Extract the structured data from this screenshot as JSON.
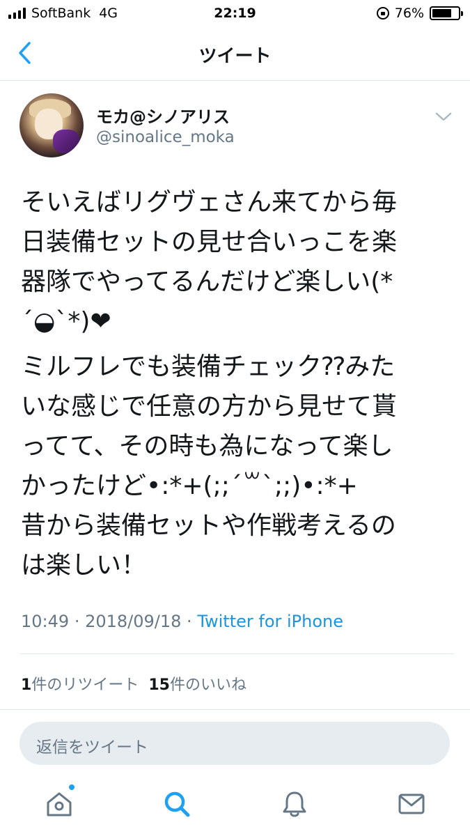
{
  "status_bar": {
    "carrier": "SoftBank",
    "network": "4G",
    "time": "22:19",
    "battery": "76%",
    "battery_level": 0.76
  },
  "nav": {
    "title": "ツイート"
  },
  "tweet": {
    "author_name": "モカ@シノアリス",
    "author_handle": "@sinoalice_moka",
    "text_lines": [
      "そいえばリグヴェさん来てから毎",
      "日装備セットの見せ合いっこを楽",
      "器隊でやってるんだけど楽しい(*",
      "´◒`*)❤",
      "ミルフレでも装備チェック⁇みた",
      "いな感じで任意の方から見せて貰",
      "ってて、その時も為になって楽し",
      "かったけど•:*+(;;´꒳`;;)•:*+",
      "昔から装備セットや作戦考えるの",
      "は楽しい！"
    ],
    "time": "10:49",
    "date": "2018/09/18",
    "source": "Twitter for iPhone"
  },
  "stats": {
    "retweet_count": "1",
    "retweet_label": "件のリツイート",
    "like_count": "15",
    "like_label": "件のいいね"
  },
  "reply": {
    "placeholder": "返信をツイート"
  },
  "tab_bar": {
    "icons": [
      "home-icon",
      "search-icon",
      "notifications-icon",
      "messages-icon"
    ],
    "accent": "#1da1f2"
  }
}
